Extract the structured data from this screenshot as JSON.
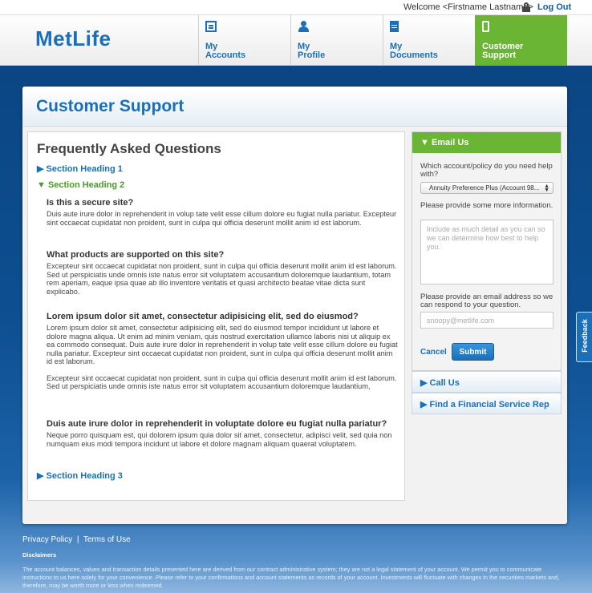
{
  "topbar": {
    "welcome": "Welcome <Firstname Lastname>",
    "logout": "Log Out"
  },
  "header": {
    "logo": "MetLife",
    "nav": [
      {
        "line1": "My",
        "line2": "Accounts",
        "icon": "accounts-icon"
      },
      {
        "line1": "My",
        "line2": "Profile",
        "icon": "profile-icon"
      },
      {
        "line1": "My",
        "line2": "Documents",
        "icon": "documents-icon"
      },
      {
        "line1": "Customer",
        "line2": "Support",
        "icon": "phone-icon",
        "active": true
      }
    ]
  },
  "page": {
    "title": "Customer Support"
  },
  "faq": {
    "title": "Frequently Asked Questions",
    "section1": "▶ Section Heading 1",
    "section2": "▼ Section Heading 2",
    "section3": "▶ Section Heading 3",
    "questions": [
      {
        "q": "Is this a secure site?",
        "a": "Duis aute irure dolor in reprehenderit in volup tate velit esse cillum dolore eu fugiat nulla pariatur. Excepteur sint occaecat cupidatat non proident, sunt in culpa qui officia deserunt mollit anim id est laborum."
      },
      {
        "q": "What products are supported on this site?",
        "a": "Excepteur sint occaecat cupidatat non proident, sunt in culpa qui officia deserunt mollit anim id est laborum. Sed ut perspiciatis unde omnis iste natus error sit voluptatem accusantium doloremque laudantium, totam rem aperiam, eaque ipsa quae ab illo inventore veritatis et quasi architecto beatae vitae dicta sunt explicabo."
      },
      {
        "q": "Lorem ipsum dolor sit amet, consectetur adipisicing elit, sed do eiusmod?",
        "a": "Lorem ipsum dolor sit amet, consectetur adipisicing elit, sed do eiusmod tempor incididunt ut labore et dolore magna aliqua. Ut enim ad minim veniam, quis nostrud exercitation ullamco laboris nisi ut aliquip ex ea commodo consequat. Duis aute irure dolor in reprehenderit in volup tate velit esse cillum dolore eu fugiat nulla pariatur. Excepteur sint occaecat cupidatat non proident, sunt in culpa qui officia deserunt mollit anim id est laborum.",
        "a2": "Excepteur sint occaecat cupidatat non proident, sunt in culpa qui officia deserunt mollit anim id est laborum. Sed ut perspiciatis unde omnis iste natus error sit voluptatem accusantium doloremque laudantium,"
      },
      {
        "q": "Duis aute irure dolor in reprehenderit in voluptate dolore eu fugiat nulla pariatur?",
        "a": "Neque porro quisquam est, qui dolorem ipsum quia dolor sit amet, consectetur, adipisci velit, sed quia non numquam eius modi tempora incidunt ut labore et dolore magnam aliquam quaerat voluptatem."
      }
    ]
  },
  "email": {
    "header": "▼ Email Us",
    "account_label": "Which account/policy do you need help with?",
    "account_value": "Annuity Preference Plus (Account 98...",
    "info_label": "Please provide some more information.",
    "info_placeholder": "Include as much detail as you can so we can determine how best to help you.",
    "email_label": "Please provide an email address so we can respond to your question.",
    "email_placeholder": "snoopy@metlife.com",
    "cancel": "Cancel",
    "submit": "Submit"
  },
  "side": {
    "call_us": "▶ Call Us",
    "find_rep": "▶ Find a Financial Service Rep"
  },
  "feedback": "Feedback",
  "footer": {
    "privacy": "Privacy Policy",
    "separator": "|",
    "terms": "Terms of Use",
    "disclaimers_heading": "Disclaimers",
    "disclaimer_text": "The account balances, values and transaction details presented here are derived from our contract administrative system; they are not a legal statement of your account. We permit you to communicate instructions to us here solely for your convenience. Please refer to your confirmations and account statements as records of your account. Investments will fluctuate with changes in the securities markets and, therefore, may be worth more or less when redeemed."
  },
  "colors": {
    "brand_blue": "#1a6fb8",
    "active_green": "#6ab533",
    "background_navy": "#0b4684"
  }
}
